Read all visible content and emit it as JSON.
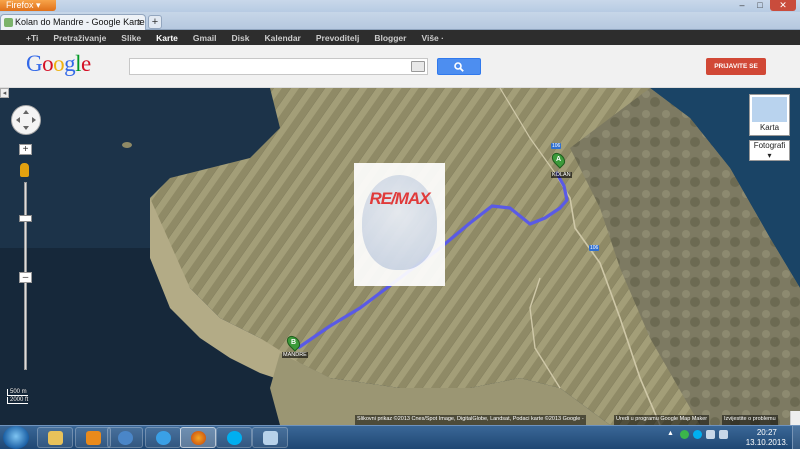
{
  "browser": {
    "menu_button": "Firefox",
    "tab_title": "Kolan do Mandre - Google Karte",
    "new_tab": "+",
    "tab_close": "x",
    "window_controls": [
      "–",
      "□",
      "✕"
    ]
  },
  "gbar": {
    "items": [
      "+Ti",
      "Pretraživanje",
      "Slike",
      "Karte",
      "Gmail",
      "Disk",
      "Kalendar",
      "Prevoditelj",
      "Blogger",
      "Više ·"
    ],
    "active": "Karte"
  },
  "header": {
    "logo": "Google",
    "search_value": "",
    "signin_label": "PRIJAVITE SE"
  },
  "map": {
    "type_label": "Karta",
    "photos_label": "Fotografi",
    "sidebar_toggle": "◂",
    "zoom_in": "+",
    "zoom_out": "–",
    "marker_a": "A",
    "marker_b": "B",
    "place_kolan": "KOLAN",
    "place_mandre": "MANDRE",
    "road_106a": "106",
    "road_106b": "106",
    "watermark": "RE/MAX",
    "scale_metric": "500 m",
    "scale_imperial": "2000 ft",
    "copyright": "Slikovni prikaz ©2013 Cnes/Spot Image, DigitalGlobe, Landsat, Podaci karte ©2013 Google -",
    "mapmaker_link": "Uredi u programu Google Map Maker",
    "report_link": "Izvijestite o problemu"
  },
  "taskbar": {
    "apps": [
      "explorer",
      "outlook",
      "network",
      "internet-explorer",
      "firefox",
      "skype",
      "notepad"
    ],
    "active_app": "firefox",
    "time": "20:27",
    "date": "13.10.2013."
  },
  "colors": {
    "route": "#5a5ae6",
    "signin": "#d14836",
    "search_button": "#4d8ef0"
  }
}
